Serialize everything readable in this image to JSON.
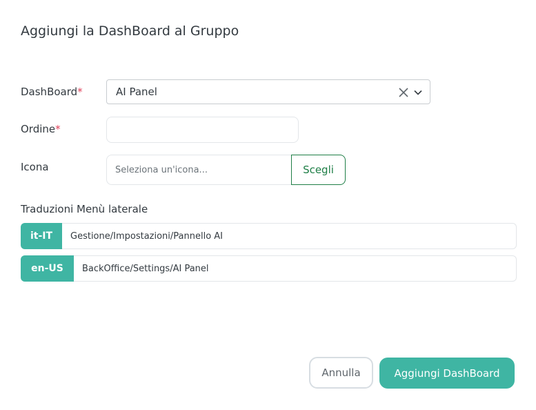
{
  "dialog": {
    "title": "Aggiungi la DashBoard al Gruppo"
  },
  "form": {
    "dashboard": {
      "label": "DashBoard",
      "required_mark": "*",
      "selected_value": "AI Panel",
      "clear_icon": "close-icon",
      "dropdown_icon": "chevron-down-icon"
    },
    "ordine": {
      "label": "Ordine",
      "required_mark": "*",
      "value": "",
      "placeholder": ""
    },
    "icona": {
      "label": "Icona",
      "placeholder": "Seleziona un'icona...",
      "value": "",
      "choose_button": "Scegli"
    }
  },
  "translations": {
    "label": "Traduzioni Menù laterale",
    "items": [
      {
        "lang": "it-IT",
        "value": "Gestione/Impostazioni/Pannello AI"
      },
      {
        "lang": "en-US",
        "value": "BackOffice/Settings/AI Panel"
      }
    ]
  },
  "footer": {
    "cancel_label": "Annulla",
    "submit_label": "Aggiungi DashBoard"
  },
  "colors": {
    "accent": "#3fb5a3",
    "choose_button": "#1e7e46",
    "required": "#e0405a",
    "text": "#333a40"
  }
}
